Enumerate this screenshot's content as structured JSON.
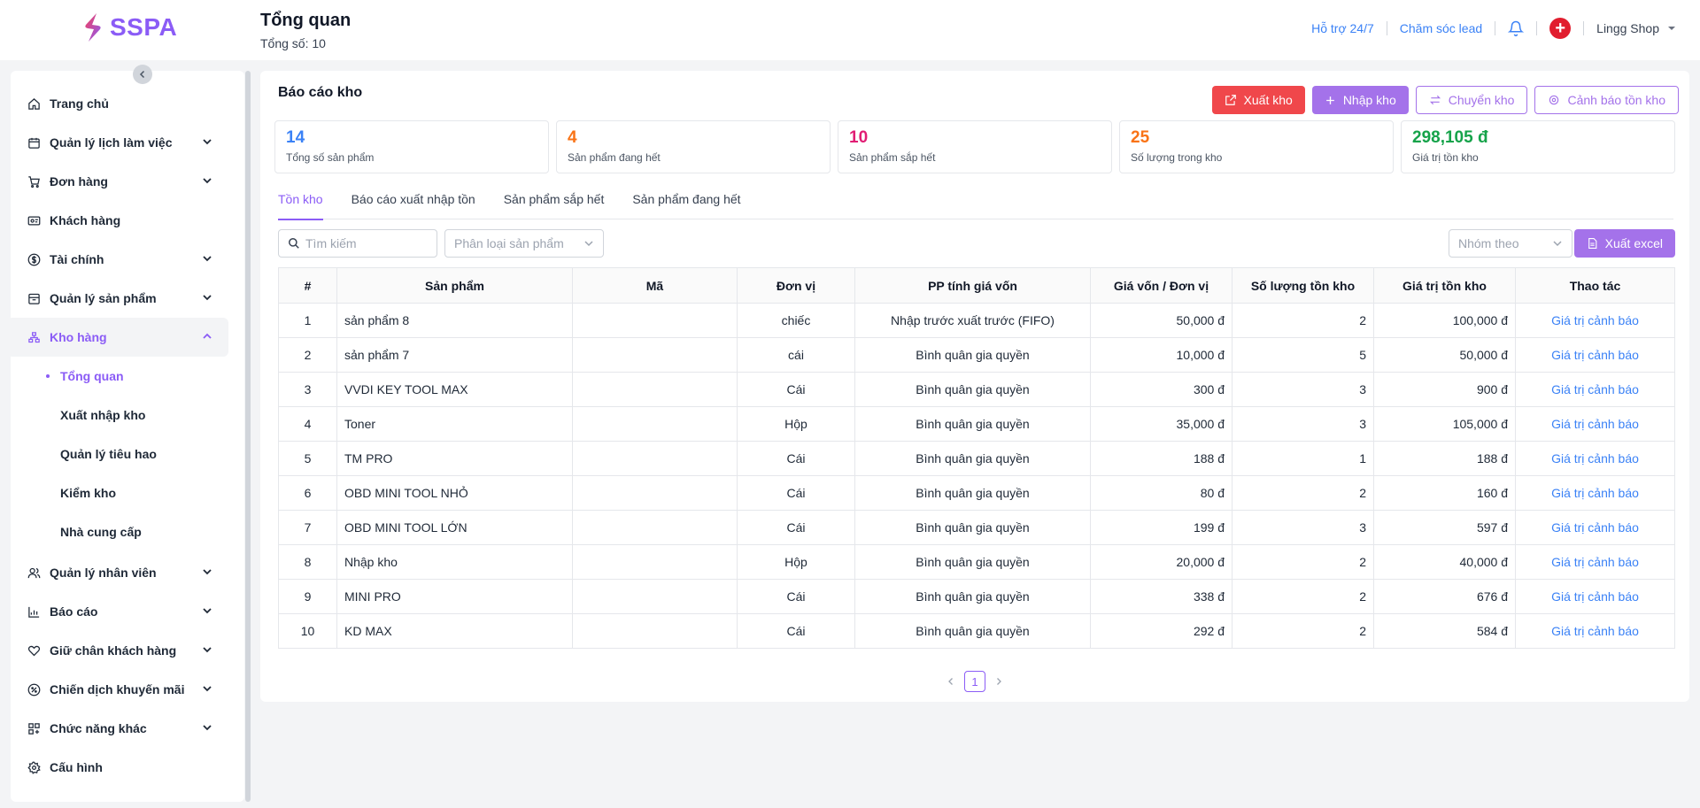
{
  "header": {
    "logo_text": "SSPA",
    "title": "Tổng quan",
    "subtitle": "Tổng số: 10",
    "support_link": "Hỗ trợ 24/7",
    "lead_link": "Chăm sóc lead",
    "shop_name": "Lingg Shop",
    "accent": "#8b5cf6"
  },
  "sidebar": {
    "items": [
      {
        "label": "Trang chủ",
        "icon": "home-icon"
      },
      {
        "label": "Quản lý lịch làm việc",
        "icon": "calendar-icon"
      },
      {
        "label": "Đơn hàng",
        "icon": "cart-icon"
      },
      {
        "label": "Khách hàng",
        "icon": "id-card-icon"
      },
      {
        "label": "Tài chính",
        "icon": "dollar-icon"
      },
      {
        "label": "Quản lý sản phẩm",
        "icon": "box-icon"
      },
      {
        "label": "Kho hàng",
        "icon": "warehouse-icon"
      },
      {
        "label": "Quản lý nhân viên",
        "icon": "users-icon"
      },
      {
        "label": "Báo cáo",
        "icon": "chart-icon"
      },
      {
        "label": "Giữ chân khách hàng",
        "icon": "heart-icon"
      },
      {
        "label": "Chiến dịch khuyến mãi",
        "icon": "discount-icon"
      },
      {
        "label": "Chức năng khác",
        "icon": "grid-icon"
      },
      {
        "label": "Cấu hình",
        "icon": "gear-icon"
      }
    ],
    "warehouse_sub": [
      "Tổng quan",
      "Xuất nhập kho",
      "Quản lý tiêu hao",
      "Kiểm kho",
      "Nhà cung cấp"
    ]
  },
  "main": {
    "title": "Báo cáo kho",
    "actions": {
      "export": "Xuất kho",
      "import": "Nhập kho",
      "transfer": "Chuyển kho",
      "alert": "Cảnh báo tồn kho"
    },
    "stats": [
      {
        "value": "14",
        "label": "Tổng số sản phẩm",
        "color": "#3b82f6"
      },
      {
        "value": "4",
        "label": "Sản phẩm đang hết",
        "color": "#f97316"
      },
      {
        "value": "10",
        "label": "Sản phẩm sắp hết",
        "color": "#e11d74"
      },
      {
        "value": "25",
        "label": "Số lượng trong kho",
        "color": "#f97316"
      },
      {
        "value": "298,105 đ",
        "label": "Giá trị tồn kho",
        "color": "#16a34a"
      }
    ],
    "tabs": [
      "Tồn kho",
      "Báo cáo xuất nhập tồn",
      "Sản phẩm sắp hết",
      "Sản phẩm đang hết"
    ],
    "filters": {
      "search_placeholder": "Tìm kiếm",
      "category_placeholder": "Phân loại sản phẩm",
      "group_placeholder": "Nhóm theo",
      "excel_button": "Xuất excel"
    },
    "table": {
      "columns": [
        "#",
        "Sản phẩm",
        "Mã",
        "Đơn vị",
        "PP tính giá vốn",
        "Giá vốn / Đơn vị",
        "Số lượng tồn kho",
        "Giá trị tồn kho",
        "Thao tác"
      ],
      "rows": [
        {
          "no": "1",
          "product": "sản phẩm 8",
          "code": "",
          "unit": "chiếc",
          "method": "Nhập trước xuất trước (FIFO)",
          "cost": "50,000 đ",
          "qty": "2",
          "value": "100,000 đ",
          "action": "Giá trị cảnh báo"
        },
        {
          "no": "2",
          "product": "sản phẩm 7",
          "code": "",
          "unit": "cái",
          "method": "Bình quân gia quyền",
          "cost": "10,000 đ",
          "qty": "5",
          "value": "50,000 đ",
          "action": "Giá trị cảnh báo"
        },
        {
          "no": "3",
          "product": "VVDI KEY TOOL MAX",
          "code": "",
          "unit": "Cái",
          "method": "Bình quân gia quyền",
          "cost": "300 đ",
          "qty": "3",
          "value": "900 đ",
          "action": "Giá trị cảnh báo"
        },
        {
          "no": "4",
          "product": "Toner",
          "code": "",
          "unit": "Hộp",
          "method": "Bình quân gia quyền",
          "cost": "35,000 đ",
          "qty": "3",
          "value": "105,000 đ",
          "action": "Giá trị cảnh báo"
        },
        {
          "no": "5",
          "product": "TM PRO",
          "code": "",
          "unit": "Cái",
          "method": "Bình quân gia quyền",
          "cost": "188 đ",
          "qty": "1",
          "value": "188 đ",
          "action": "Giá trị cảnh báo"
        },
        {
          "no": "6",
          "product": "OBD MINI TOOL NHỎ",
          "code": "",
          "unit": "Cái",
          "method": "Bình quân gia quyền",
          "cost": "80 đ",
          "qty": "2",
          "value": "160 đ",
          "action": "Giá trị cảnh báo"
        },
        {
          "no": "7",
          "product": "OBD MINI TOOL LỚN",
          "code": "",
          "unit": "Cái",
          "method": "Bình quân gia quyền",
          "cost": "199 đ",
          "qty": "3",
          "value": "597 đ",
          "action": "Giá trị cảnh báo"
        },
        {
          "no": "8",
          "product": "Nhập kho",
          "code": "",
          "unit": "Hộp",
          "method": "Bình quân gia quyền",
          "cost": "20,000 đ",
          "qty": "2",
          "value": "40,000 đ",
          "action": "Giá trị cảnh báo"
        },
        {
          "no": "9",
          "product": "MINI PRO",
          "code": "",
          "unit": "Cái",
          "method": "Bình quân gia quyền",
          "cost": "338 đ",
          "qty": "2",
          "value": "676 đ",
          "action": "Giá trị cảnh báo"
        },
        {
          "no": "10",
          "product": "KD MAX",
          "code": "",
          "unit": "Cái",
          "method": "Bình quân gia quyền",
          "cost": "292 đ",
          "qty": "2",
          "value": "584 đ",
          "action": "Giá trị cảnh báo"
        }
      ]
    },
    "pagination": {
      "current": "1"
    }
  }
}
